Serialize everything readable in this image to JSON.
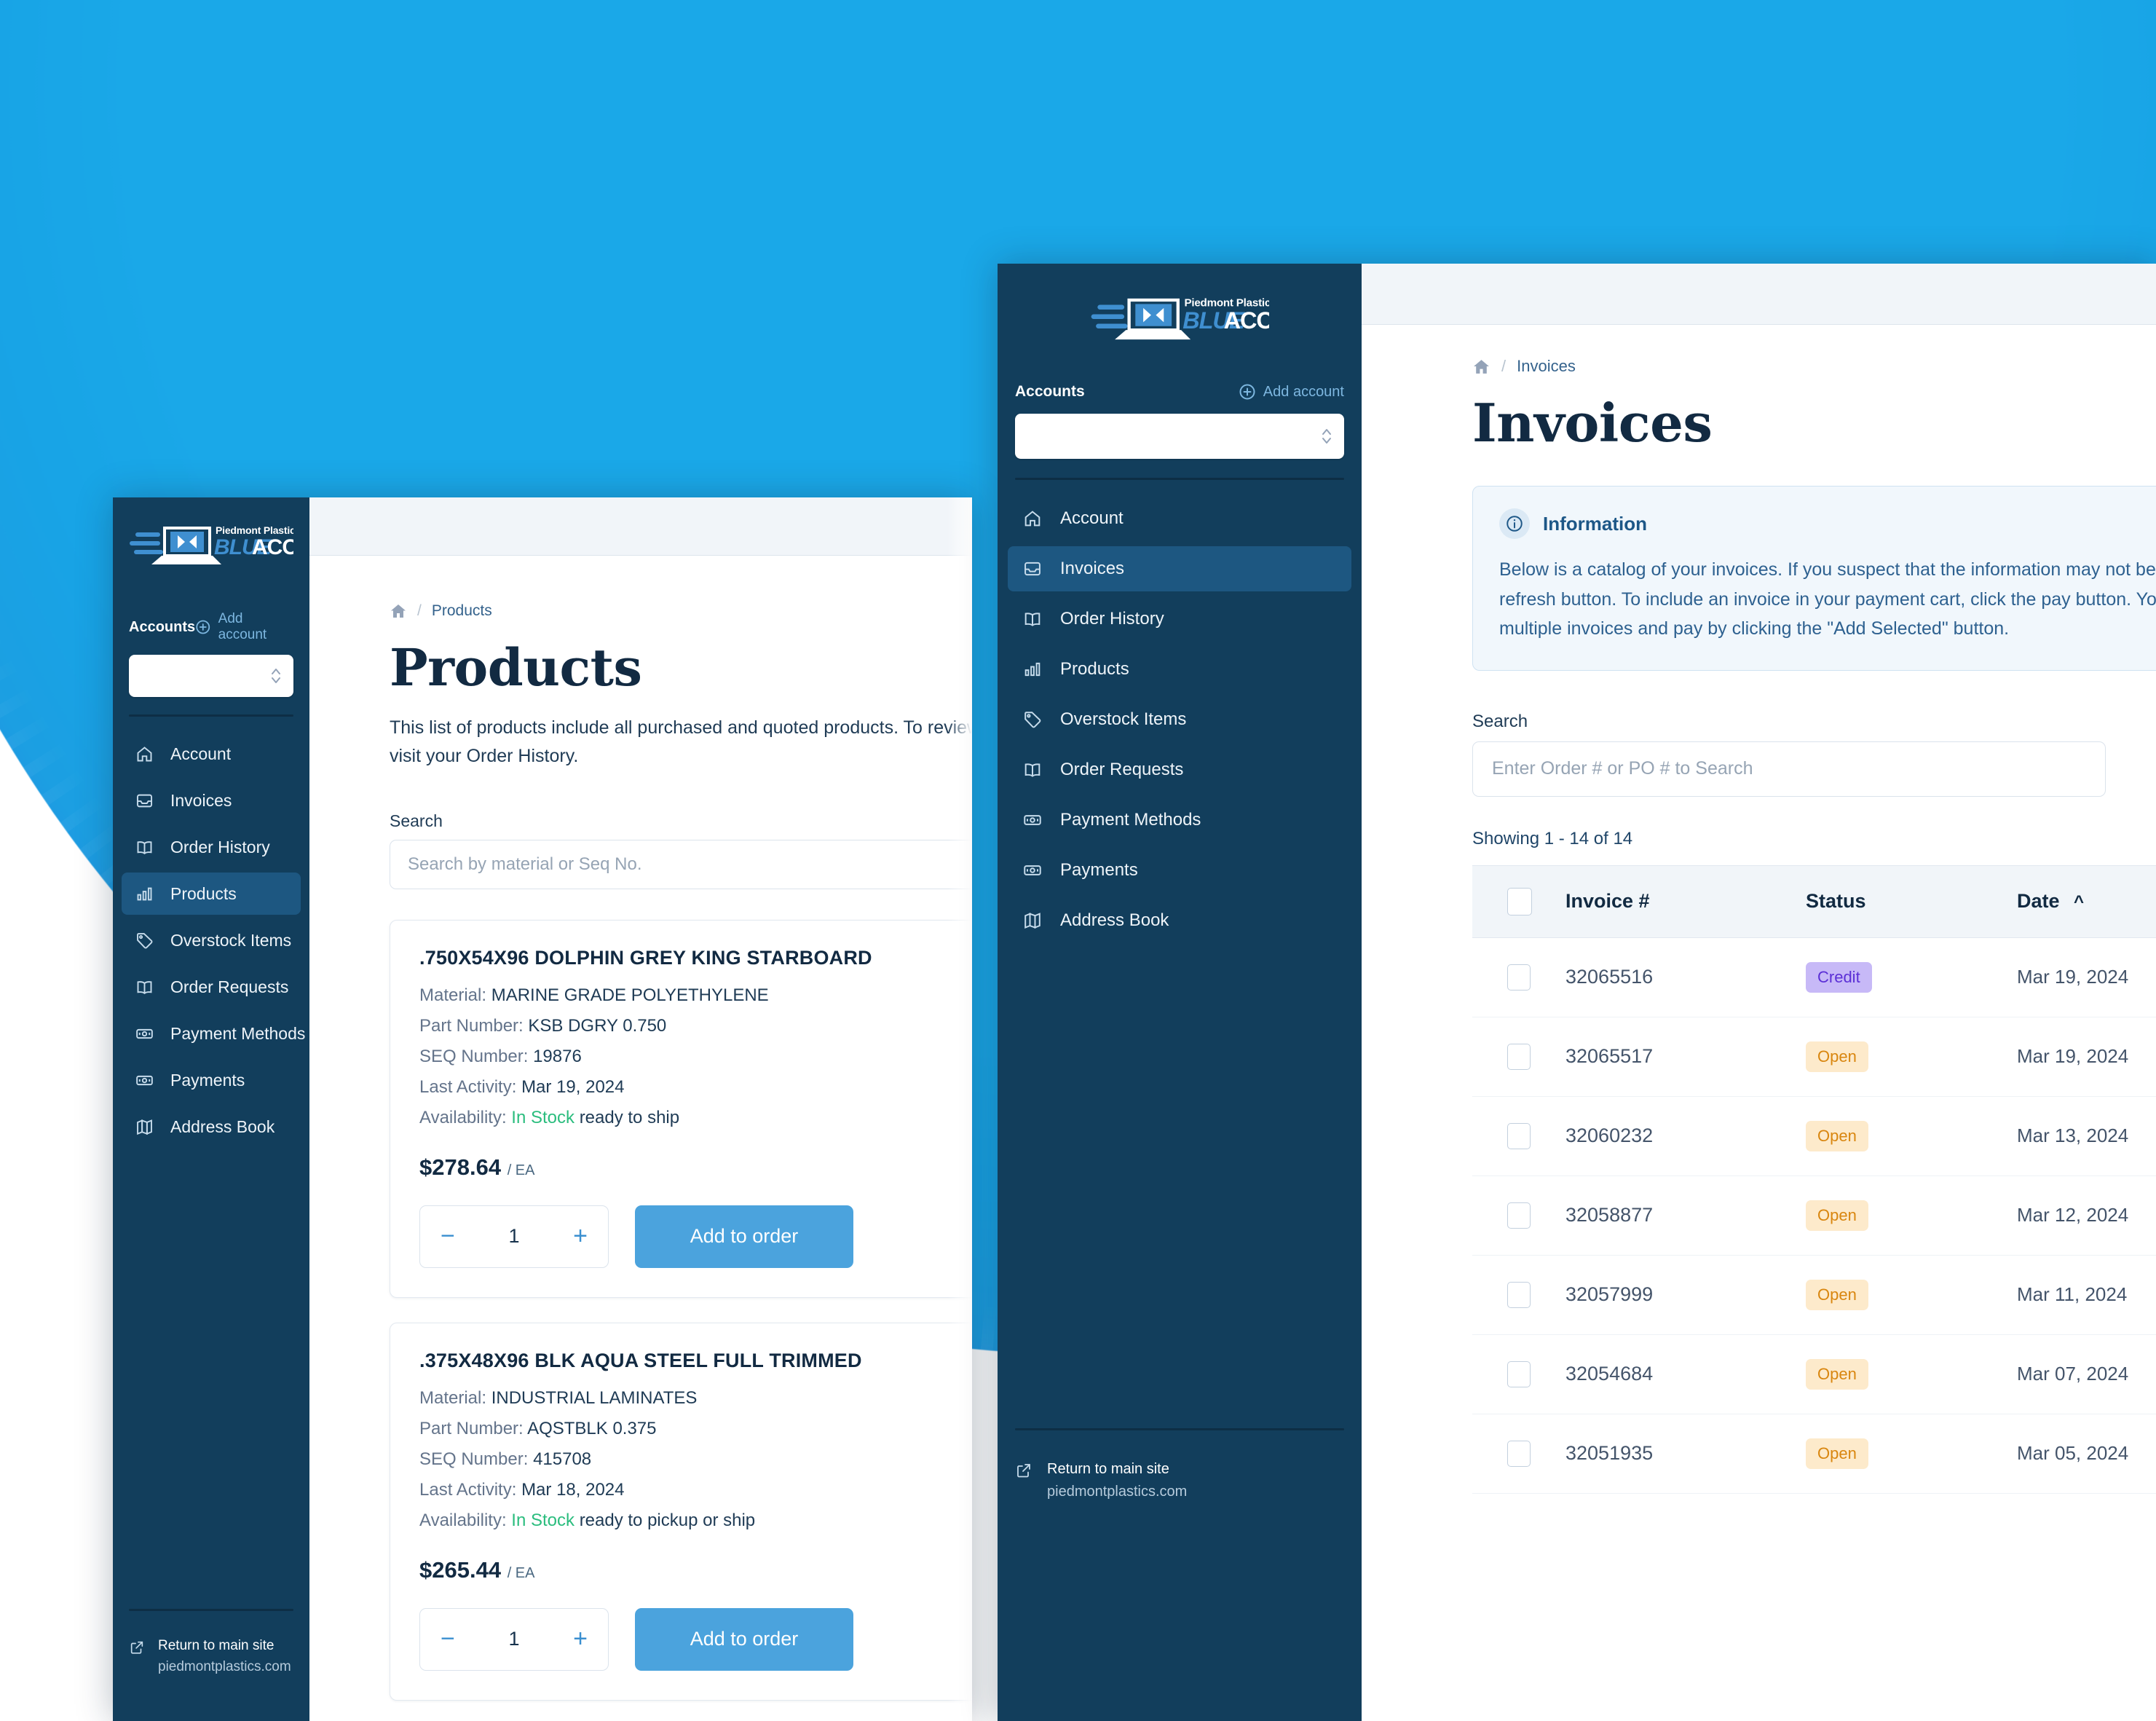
{
  "brand": {
    "kicker": "Piedmont Plastics",
    "word_blue": "BLUE",
    "word_white": "ACCOUNT"
  },
  "sidebar": {
    "accounts_label": "Accounts",
    "add_account_label": "Add account",
    "account_select_value": "",
    "items": [
      {
        "label": "Account",
        "icon": "home-icon"
      },
      {
        "label": "Invoices",
        "icon": "inbox-icon"
      },
      {
        "label": "Order History",
        "icon": "book-open-icon"
      },
      {
        "label": "Products",
        "icon": "bar-chart-icon"
      },
      {
        "label": "Overstock Items",
        "icon": "tag-icon"
      },
      {
        "label": "Order Requests",
        "icon": "book-open-icon"
      },
      {
        "label": "Payment Methods",
        "icon": "banknote-icon"
      },
      {
        "label": "Payments",
        "icon": "banknote-icon"
      },
      {
        "label": "Address Book",
        "icon": "map-icon"
      }
    ],
    "return_title": "Return to main site",
    "return_domain": "piedmontplastics.com"
  },
  "products_window": {
    "active_nav": "Products",
    "breadcrumb": {
      "home_icon": "home-icon",
      "separator": "/",
      "current": "Products"
    },
    "title": "Products",
    "description": "This list of products include all purchased and quoted products. To review a specific order please visit your Order History.",
    "search_label": "Search",
    "search_placeholder": "Search by material or Seq No.",
    "search_value": "",
    "labels": {
      "material": "Material:",
      "part_number": "Part Number:",
      "seq_number": "SEQ Number:",
      "last_activity": "Last Activity:",
      "availability": "Availability:",
      "unit": "/ EA",
      "add_to_order": "Add to order",
      "minus": "−",
      "plus": "+"
    },
    "cards": [
      {
        "title": ".750X54X96 DOLPHIN GREY KING STARBOARD",
        "material": "MARINE GRADE POLYETHYLENE",
        "part_number": "KSB DGRY 0.750",
        "seq_number": "19876",
        "last_activity": "Mar 19, 2024",
        "stock_status": "In Stock",
        "stock_detail": "ready to ship",
        "price": "$278.64",
        "quantity": "1"
      },
      {
        "title": ".375X48X96 BLK AQUA STEEL FULL TRIMMED",
        "material": "INDUSTRIAL LAMINATES",
        "part_number": "AQSTBLK 0.375",
        "seq_number": "415708",
        "last_activity": "Mar 18, 2024",
        "stock_status": "In Stock",
        "stock_detail": "ready to pickup or ship",
        "price": "$265.44",
        "quantity": "1"
      }
    ]
  },
  "invoices_window": {
    "active_nav": "Invoices",
    "breadcrumb": {
      "home_icon": "home-icon",
      "separator": "/",
      "current": "Invoices"
    },
    "title": "Invoices",
    "info": {
      "heading": "Information",
      "icon": "info-circle-icon",
      "body": "Below is a catalog of your invoices. If you suspect that the information may not be up to date, click the refresh button. To include an invoice in your payment cart, click the pay button. You can also select multiple invoices and pay by clicking the \"Add Selected\" button."
    },
    "search_label": "Search",
    "search_placeholder": "Enter Order # or PO # to Search",
    "search_value": "",
    "showing": "Showing 1 - 14 of 14",
    "table": {
      "sort_column": "Date",
      "sort_direction": "asc",
      "sort_caret": "^",
      "columns": [
        "",
        "Invoice #",
        "Status",
        "Date"
      ],
      "rows": [
        {
          "selected": false,
          "invoice": "32065516",
          "status": "Credit",
          "status_kind": "credit",
          "date": "Mar 19, 2024"
        },
        {
          "selected": false,
          "invoice": "32065517",
          "status": "Open",
          "status_kind": "open",
          "date": "Mar 19, 2024"
        },
        {
          "selected": false,
          "invoice": "32060232",
          "status": "Open",
          "status_kind": "open",
          "date": "Mar 13, 2024"
        },
        {
          "selected": false,
          "invoice": "32058877",
          "status": "Open",
          "status_kind": "open",
          "date": "Mar 12, 2024"
        },
        {
          "selected": false,
          "invoice": "32057999",
          "status": "Open",
          "status_kind": "open",
          "date": "Mar 11, 2024"
        },
        {
          "selected": false,
          "invoice": "32054684",
          "status": "Open",
          "status_kind": "open",
          "date": "Mar 07, 2024"
        },
        {
          "selected": false,
          "invoice": "32051935",
          "status": "Open",
          "status_kind": "open",
          "date": "Mar 05, 2024"
        }
      ]
    }
  },
  "colors": {
    "sidebar_bg": "#13405e",
    "sidebar_active": "#1d5781",
    "accent_blue": "#4ba3dd",
    "glow_blue": "#1aa8e8",
    "in_stock_green": "#2bbd7e",
    "badge_credit_bg": "#c7b9f7",
    "badge_credit_fg": "#5b2fd6",
    "badge_open_bg": "#fdeacb",
    "badge_open_fg": "#d9860f",
    "title_ink": "#122a42"
  }
}
